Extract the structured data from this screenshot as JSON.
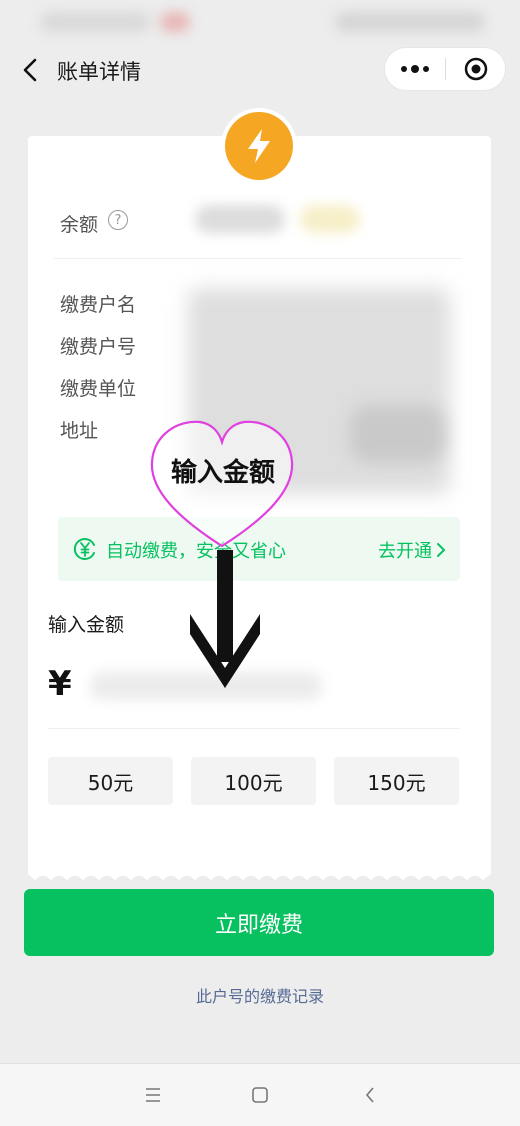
{
  "navbar": {
    "title": "账单详情"
  },
  "card": {
    "balance_label": "余额",
    "help_glyph": "?",
    "fields": [
      {
        "label": "缴费户名"
      },
      {
        "label": "缴费户号"
      },
      {
        "label": "缴费单位"
      },
      {
        "label": "地址"
      }
    ],
    "auto_pay": {
      "text": "自动缴费，安全又省心",
      "link": "去开通"
    },
    "amount_label": "输入金额",
    "currency": "¥",
    "quick_amounts": [
      "50元",
      "100元",
      "150元"
    ]
  },
  "annotation": {
    "heart_text": "输入金额"
  },
  "pay_button": "立即缴费",
  "record_link": "此户号的缴费记录",
  "colors": {
    "brand_green": "#07c160",
    "lightning_orange": "#f5a623",
    "annotation_magenta": "#e040e0",
    "link_blue": "#576b95"
  },
  "icons": {
    "lightning": "lightning-icon",
    "back": "chevron-left-icon",
    "more": "more-dots-icon",
    "close": "target-close-icon",
    "help": "question-circle-icon",
    "auto_pay": "yen-cycle-icon",
    "nav_menu": "menu-lines-icon",
    "nav_home": "square-home-icon",
    "nav_back": "back-chevron-icon"
  }
}
